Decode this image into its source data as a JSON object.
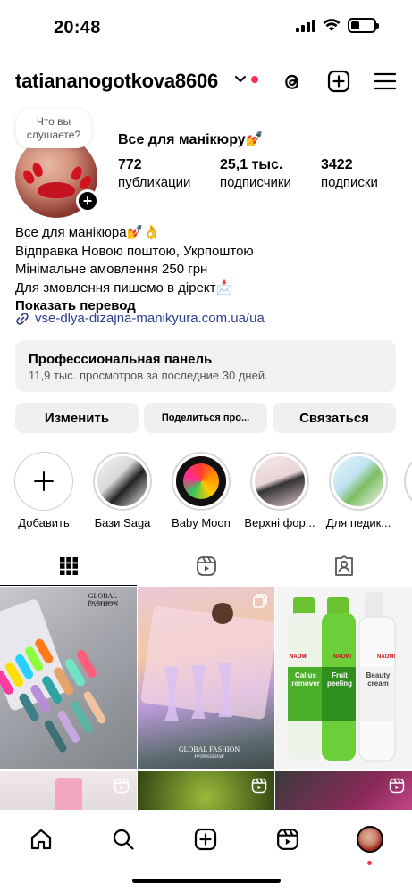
{
  "status_bar": {
    "time": "20:48",
    "icons": [
      "cellular-signal-icon",
      "wifi-icon",
      "battery-icon"
    ]
  },
  "header": {
    "username": "tatiananogotkova8606",
    "icons": [
      "chevron-down-icon",
      "threads-icon",
      "plus-square-icon",
      "menu-icon"
    ],
    "accent_dot_color": "#ff2d55"
  },
  "profile": {
    "note_text": "Что вы слушаете?",
    "category": "Все для манікюру💅",
    "stats": [
      {
        "value": "772",
        "label": "публикации"
      },
      {
        "value": "25,1 тыс.",
        "label": "подписчики"
      },
      {
        "value": "3422",
        "label": "подписки"
      }
    ],
    "bio": [
      "Все для манікюра💅👌",
      "Відправка Новою поштою, Укрпоштою",
      "Мінімальне амовлення 250 грн",
      "Для змовлення пишемо в дірект📩"
    ],
    "translate_label": "Показать перевод",
    "link": "vse-dlya-dizajna-manikyura.com.ua/ua"
  },
  "pro_panel": {
    "title": "Профессиональная панель",
    "subtitle": "11,9 тыс. просмотров за последние 30 дней."
  },
  "buttons": {
    "edit": "Изменить",
    "share": "Поделиться про...",
    "contact": "Связаться"
  },
  "highlights": [
    {
      "label": "Добавить"
    },
    {
      "label": "Бази Saga"
    },
    {
      "label": "Baby Moon"
    },
    {
      "label": "Верхні фор..."
    },
    {
      "label": "Для педик..."
    }
  ],
  "tabs": [
    "grid-icon",
    "reels-icon",
    "tagged-icon"
  ],
  "grid_posts": [
    {
      "brand": "GLOBAL FASHION",
      "sub": "Professional"
    },
    {
      "brand": "GLOBAL FASHION",
      "sub": "Professional"
    },
    {
      "products": [
        "Callus remover",
        "Fruit peeling",
        "Beauty cream"
      ],
      "brand": "NAOMI"
    }
  ],
  "bottom_nav": [
    "home-icon",
    "search-icon",
    "create-icon",
    "reels-icon",
    "profile-avatar"
  ]
}
